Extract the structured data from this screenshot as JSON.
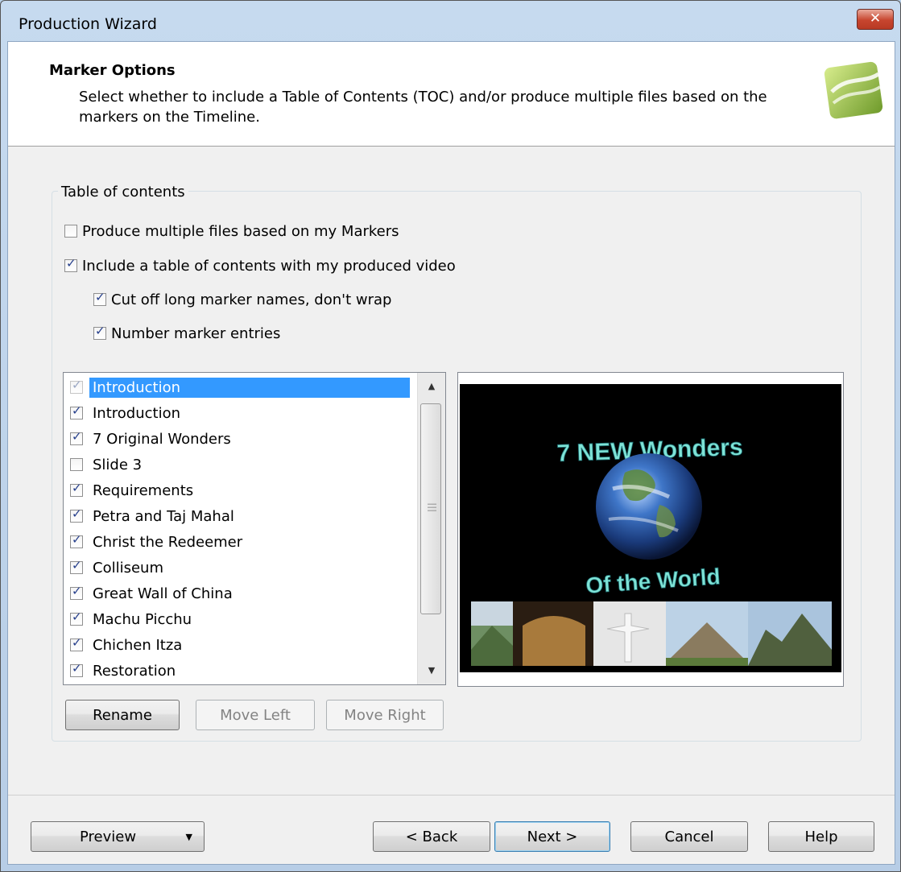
{
  "window": {
    "title": "Production Wizard",
    "close_glyph": "✕"
  },
  "header": {
    "title": "Marker Options",
    "description": "Select whether to include a Table of Contents (TOC) and/or produce multiple files based on the markers on the Timeline.",
    "logo_icon": "camtasia-logo-icon"
  },
  "toc_group": {
    "label": "Table of contents",
    "options": [
      {
        "label": "Produce multiple files based on my Markers",
        "checked": false
      },
      {
        "label": "Include a table of contents with my produced video",
        "checked": true
      },
      {
        "label": "Cut off long marker names, don't wrap",
        "checked": true
      },
      {
        "label": "Number marker entries",
        "checked": true
      }
    ]
  },
  "marker_list": [
    {
      "label": "Introduction",
      "checked": true,
      "disabled": true,
      "selected": true
    },
    {
      "label": "Introduction",
      "checked": true
    },
    {
      "label": "7 Original Wonders",
      "checked": true
    },
    {
      "label": "Slide 3",
      "checked": false
    },
    {
      "label": "Requirements",
      "checked": true
    },
    {
      "label": "Petra and Taj Mahal",
      "checked": true
    },
    {
      "label": "Christ the Redeemer",
      "checked": true
    },
    {
      "label": "Colliseum",
      "checked": true
    },
    {
      "label": "Great Wall of China",
      "checked": true
    },
    {
      "label": "Machu Picchu",
      "checked": true
    },
    {
      "label": "Chichen Itza",
      "checked": true
    },
    {
      "label": "Restoration",
      "checked": true
    }
  ],
  "preview": {
    "title_top": "7 NEW Wonders",
    "title_bottom": "Of the World",
    "accent_color": "#7fe3d6"
  },
  "list_buttons": {
    "rename": "Rename",
    "move_left": "Move Left",
    "move_right": "Move Right"
  },
  "footer": {
    "preview": "Preview",
    "back": "< Back",
    "next": "Next >",
    "cancel": "Cancel",
    "help": "Help"
  }
}
